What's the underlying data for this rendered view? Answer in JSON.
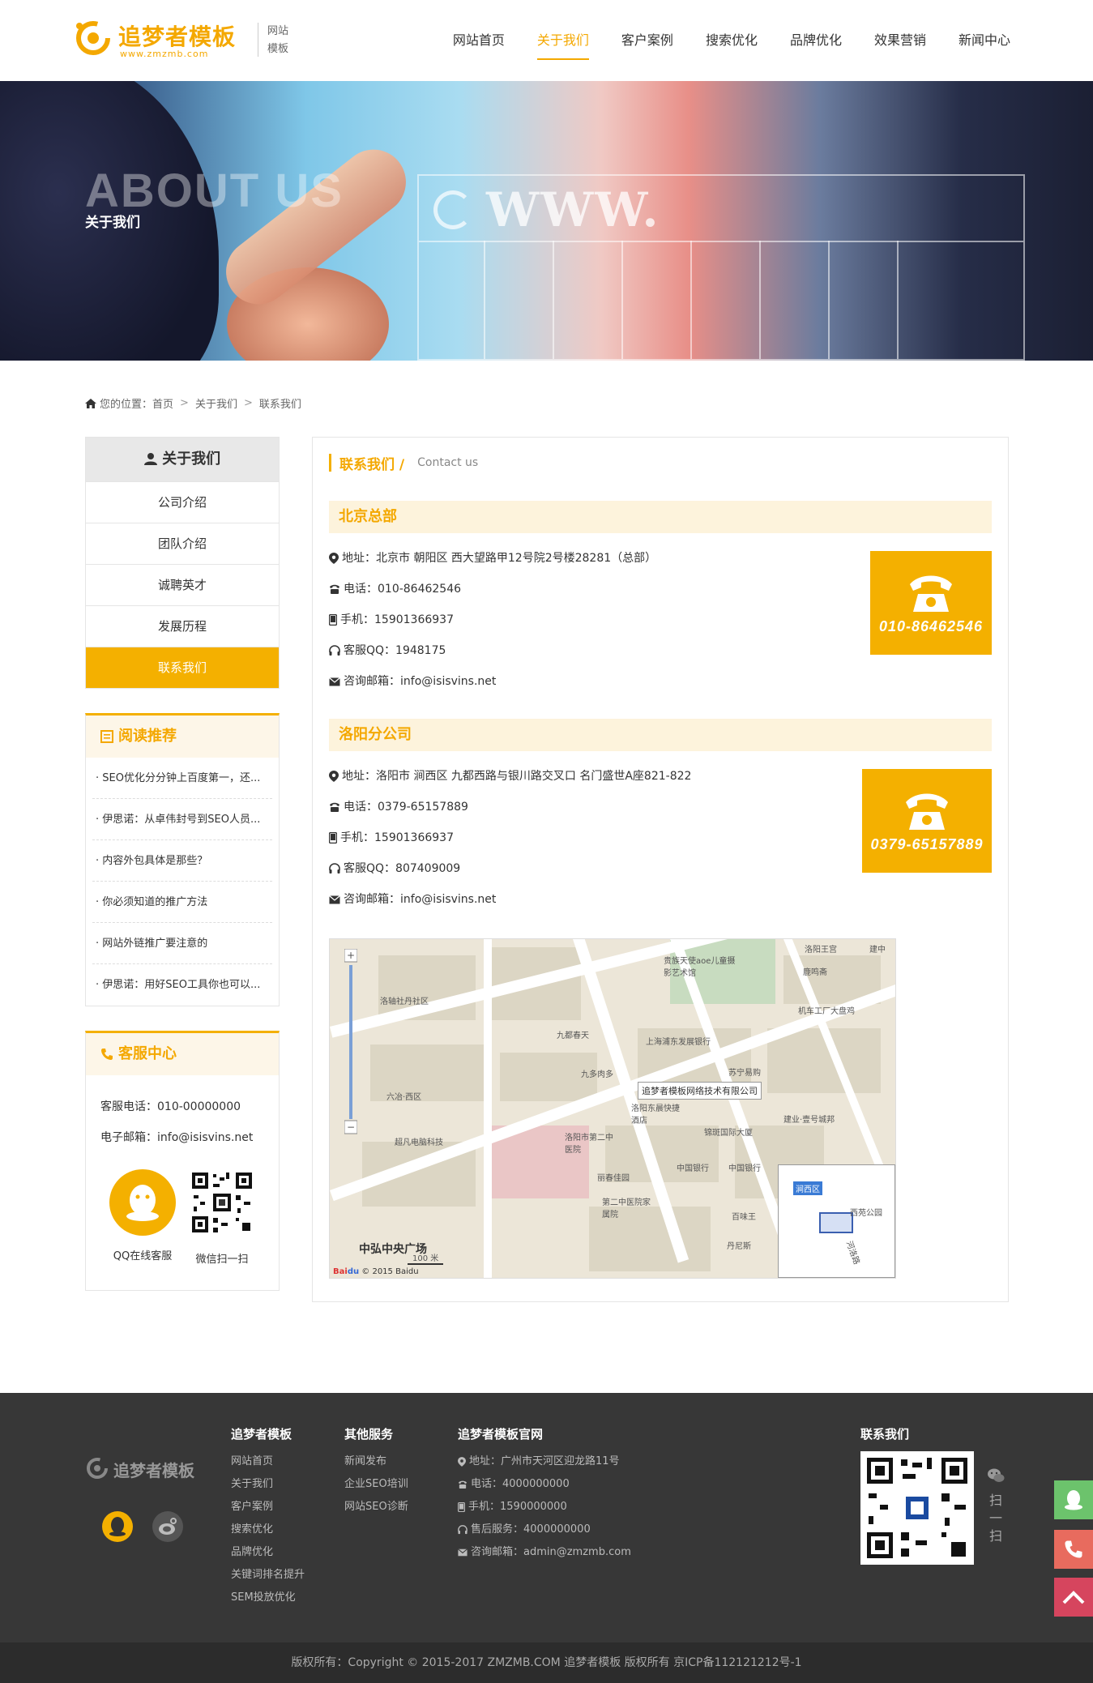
{
  "header": {
    "logo_text": "追梦者模板",
    "logo_sub": "www.zmzmb.com",
    "slogan": "网站模板",
    "nav": [
      "网站首页",
      "关于我们",
      "客户案例",
      "搜索优化",
      "品牌优化",
      "效果营销",
      "新闻中心"
    ],
    "active_nav": 1
  },
  "banner": {
    "title_en": "ABOUT US",
    "title_cn": "关于我们",
    "www": "WWW."
  },
  "breadcrumb": {
    "prefix": "您的位置：",
    "items": [
      "首页",
      "关于我们",
      "联系我们"
    ],
    "sep": ">"
  },
  "sidebar": {
    "title": "关于我们",
    "items": [
      "公司介绍",
      "团队介绍",
      "诚聘英才",
      "发展历程",
      "联系我们"
    ],
    "active": 4,
    "reading": {
      "title": "阅读推荐",
      "items": [
        "· SEO优化分分钟上百度第一，还...",
        "· 伊思诺：从卓伟封号到SEO人员...",
        "· 内容外包具体是那些？",
        "· 你必须知道的推广方法",
        "· 网站外链推广要注意的",
        "· 伊思诺：用好SEO工具你也可以..."
      ]
    },
    "service": {
      "title": "客服中心",
      "phone": "客服电话：010-00000000",
      "email": "电子邮箱：info@isisvins.net",
      "qq_label": "QQ在线客服",
      "wechat_label": "微信扫一扫"
    }
  },
  "main": {
    "title_cn": "联系我们 /",
    "title_en": "Contact us",
    "branches": [
      {
        "name": "北京总部",
        "address": "地址：北京市 朝阳区 西大望路甲12号院2号楼28281（总部）",
        "tel": "电话：010-86462546",
        "mobile": "手机：15901366937",
        "qq": "客服QQ：1948175",
        "email": "咨询邮箱：info@isisvins.net",
        "badge": "010-86462546"
      },
      {
        "name": "洛阳分公司",
        "address": "地址：洛阳市 涧西区 九都西路与银川路交叉口 名门盛世A座821-822",
        "tel": "电话：0379-65157889",
        "mobile": "手机：15901366937",
        "qq": "客服QQ：807409009",
        "email": "咨询邮箱：info@isisvins.net",
        "badge": "0379-65157889"
      }
    ],
    "map": {
      "company_label": "追梦者模板网络技术有限公司",
      "labels": [
        "洛轴社丹社区",
        "九都春天",
        "上海浦东发展银行",
        "苏宁易购",
        "九多肉多",
        "六冶·西区",
        "洛阳东晨快捷酒店",
        "锦斑国际大厦",
        "洛阳市第二中医院",
        "丽春佳园",
        "中国银行",
        "中国银行",
        "第二中医院家属院",
        "百味王",
        "丹尼斯",
        "超凡电脑科技",
        "机车工厂大盘鸡",
        "建业·壹号城邦",
        "洛阳王宫",
        "鹿鸣斋",
        "建中",
        "贵族天使aoe儿童摄影艺术馆",
        "涧西区",
        "西苑公园",
        "河洛路"
      ],
      "area_label": "中弘中央广场",
      "scale": "100 米",
      "copyright": "© 2015 Baidu"
    }
  },
  "footer": {
    "logo": "追梦者模板",
    "col1": {
      "title": "追梦者模板",
      "items": [
        "网站首页",
        "关于我们",
        "客户案例",
        "搜索优化",
        "品牌优化",
        "关键词排名提升",
        "SEM投放优化"
      ]
    },
    "col2": {
      "title": "其他服务",
      "items": [
        "新闻发布",
        "企业SEO培训",
        "网站SEO诊断"
      ]
    },
    "col3": {
      "title": "追梦者模板官网",
      "items": [
        "地址：广州市天河区迎龙路11号",
        "电话：4000000000",
        "手机：1590000000",
        "售后服务：4000000000",
        "咨询邮箱：admin@zmzmb.com"
      ]
    },
    "col4": {
      "title": "联系我们"
    },
    "scan": "扫一扫",
    "copyright": "版权所有：Copyright © 2015-2017 ZMZMB.COM 追梦者模板 版权所有 京ICP备112121212号-1"
  },
  "colors": {
    "accent": "#f4b000",
    "footer_bg": "#373737",
    "float_qq": "#6cc36c",
    "float_phone": "#e86b5e",
    "float_top": "#d6455e"
  }
}
